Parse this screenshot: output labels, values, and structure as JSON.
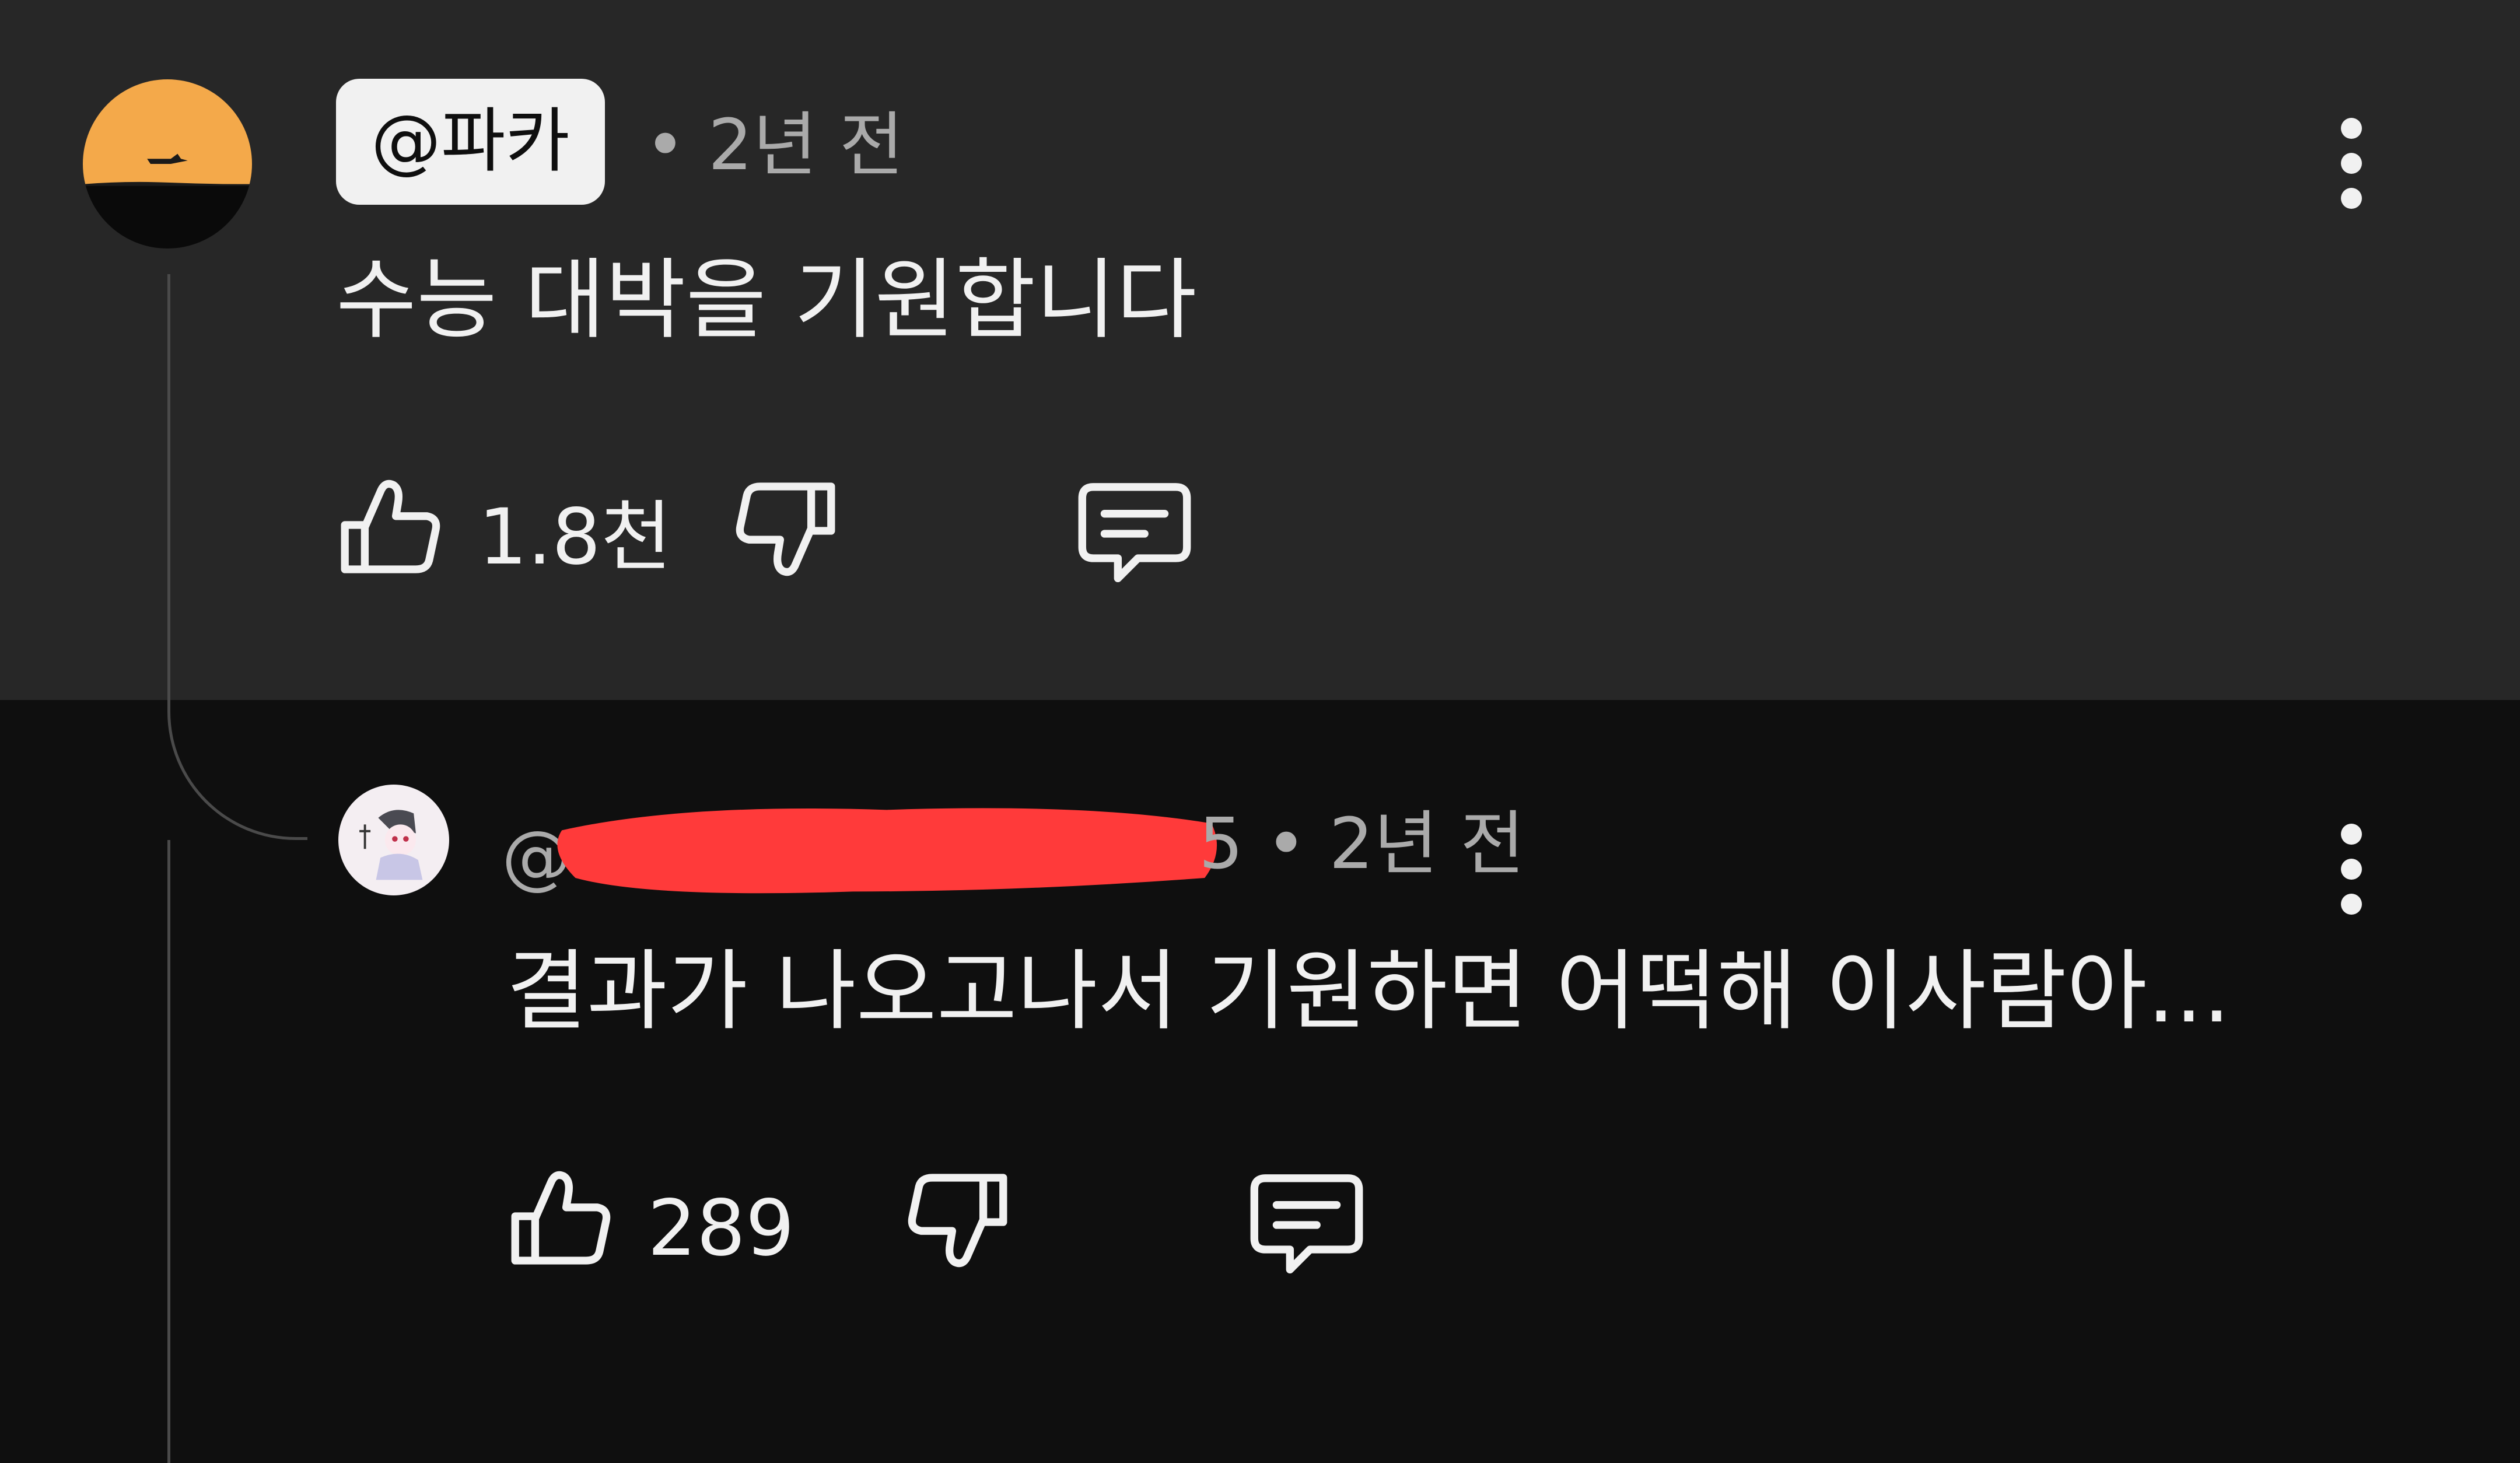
{
  "parent_comment": {
    "author": "@파카",
    "meta": "• 2년 전",
    "text": "수능 대박을 기원합니다",
    "like_count": "1.8천",
    "icons": {
      "avatar": "sunset-silhouette-avatar",
      "like": "thumbs-up-icon",
      "dislike": "thumbs-down-icon",
      "reply": "comment-reply-icon",
      "more": "more-vert-icon"
    }
  },
  "reply_comment": {
    "author_visible_prefix": "@",
    "meta": "5 • 2년 전",
    "text": "결과가 나오고나서 기원하면 어떡해 이사람아...",
    "like_count": "289",
    "icons": {
      "avatar": "anime-character-avatar",
      "like": "thumbs-up-icon",
      "dislike": "thumbs-down-icon",
      "reply": "comment-reply-icon",
      "more": "more-vert-icon"
    }
  },
  "colors": {
    "top_background": "#272727",
    "bottom_background": "#0f0f0f",
    "text_primary": "#f1f1f1",
    "text_secondary": "#aaaaaa",
    "redaction": "#ff3a3a",
    "avatar_sunset": "#f4a94a"
  }
}
